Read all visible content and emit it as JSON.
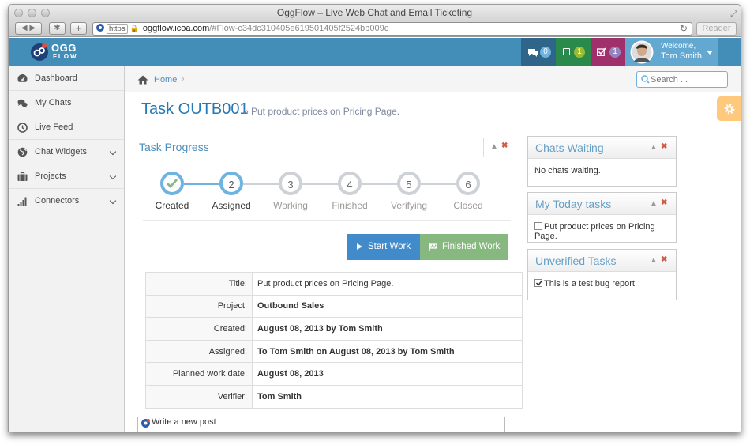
{
  "window": {
    "title": "OggFlow – Live Web Chat and Email Ticketing"
  },
  "browser": {
    "https": "https",
    "domain": "oggflow.icoa.com",
    "path": "/#Flow-c34dc310405e619501405f2524bb009c",
    "reader": "Reader"
  },
  "header": {
    "logo_top": "OGG",
    "logo_bottom": "FLOW",
    "counters": [
      {
        "icon": "chat-icon",
        "count": "0",
        "bg": "#2e6589",
        "badge": "#6fb3e0"
      },
      {
        "icon": "square-icon",
        "count": "1",
        "bg": "#2a8a4c",
        "badge": "#9abc32"
      },
      {
        "icon": "checkbox-icon",
        "count": "1",
        "bg": "#a0306b",
        "badge": "#9585bf"
      }
    ],
    "welcome": "Welcome,",
    "user": "Tom Smith"
  },
  "sidebar": {
    "items": [
      {
        "label": "Dashboard",
        "icon": "dashboard-icon"
      },
      {
        "label": "My Chats",
        "icon": "chats-icon"
      },
      {
        "label": "Live Feed",
        "icon": "clock-icon"
      },
      {
        "label": "Chat Widgets",
        "icon": "globe-icon"
      },
      {
        "label": "Projects",
        "icon": "briefcase-icon"
      },
      {
        "label": "Connectors",
        "icon": "signal-icon"
      }
    ]
  },
  "breadcrumb": {
    "home": "Home",
    "search_placeholder": "Search ..."
  },
  "page": {
    "title": "Task OUTB001",
    "subtitle": "» Put product prices on Pricing Page."
  },
  "progress": {
    "title": "Task Progress",
    "steps": [
      {
        "num": "1",
        "label": "Created",
        "state": "done"
      },
      {
        "num": "2",
        "label": "Assigned",
        "state": "active"
      },
      {
        "num": "3",
        "label": "Working",
        "state": "todo"
      },
      {
        "num": "4",
        "label": "Finished",
        "state": "todo"
      },
      {
        "num": "5",
        "label": "Verifying",
        "state": "todo"
      },
      {
        "num": "6",
        "label": "Closed",
        "state": "todo"
      }
    ],
    "start_button": "Start Work",
    "finished_button": "Finished Work"
  },
  "details": [
    {
      "key": "Title:",
      "value": "Put product prices on Pricing Page."
    },
    {
      "key": "Project:",
      "value": "Outbound Sales"
    },
    {
      "key": "Created:",
      "value": "August 08, 2013 by Tom Smith"
    },
    {
      "key": "Assigned:",
      "value": "To Tom Smith on August 08, 2013 by Tom Smith"
    },
    {
      "key": "Planned work date:",
      "value": "August 08, 2013"
    },
    {
      "key": "Verifier:",
      "value": "Tom Smith"
    }
  ],
  "post_placeholder": "Write a new post",
  "widgets": {
    "chats_waiting": {
      "title": "Chats Waiting",
      "body": "No chats waiting."
    },
    "today_tasks": {
      "title": "My Today tasks",
      "item": "Put product prices on Pricing Page."
    },
    "unverified": {
      "title": "Unverified Tasks",
      "item": "This is a test bug report."
    }
  }
}
